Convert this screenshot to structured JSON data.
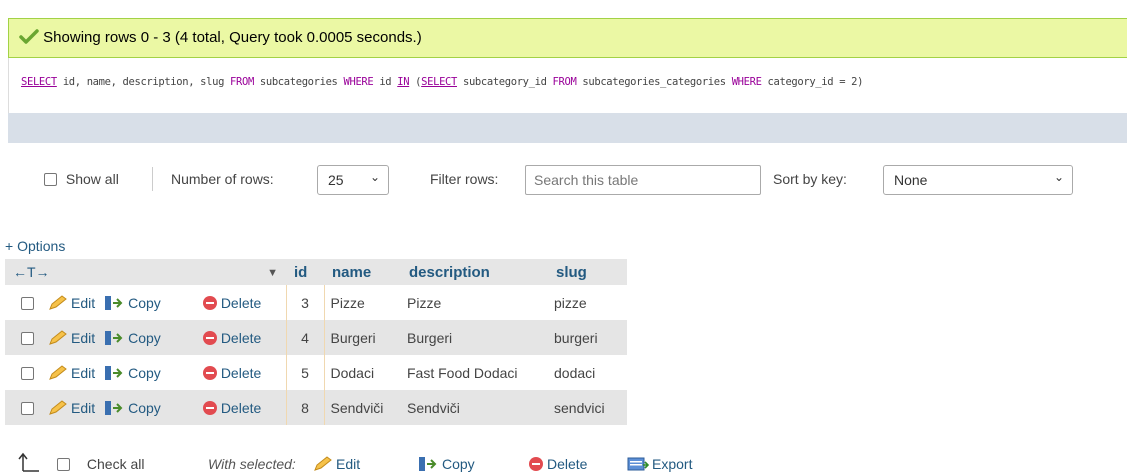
{
  "status": {
    "message": "Showing rows 0 - 3 (4 total, Query took 0.0005 seconds.)",
    "color": "#ebf8a4"
  },
  "sql": {
    "kw_select": "SELECT",
    "part1": " id, name, description, slug ",
    "kw_from": "FROM",
    "part2": " subcategories ",
    "kw_where": "WHERE",
    "part3": " id ",
    "kw_in": "IN",
    "part4": " (",
    "kw_select2": "SELECT",
    "part5": " subcategory_id ",
    "kw_from2": "FROM",
    "part6": " subcategories_categories ",
    "kw_where2": "WHERE",
    "part7": " category_id = 2)"
  },
  "nav": {
    "show_all": "Show all",
    "number_of_rows_label": "Number of rows:",
    "rows_value": "25",
    "filter_label": "Filter rows:",
    "filter_placeholder": "Search this table",
    "sort_label": "Sort by key:",
    "sort_value": "None"
  },
  "options_link": "+ Options",
  "table": {
    "arrows": "←T→",
    "columns": [
      "id",
      "name",
      "description",
      "slug"
    ],
    "actions": {
      "edit": "Edit",
      "copy": "Copy",
      "delete": "Delete"
    },
    "rows": [
      {
        "id": "3",
        "name": "Pizze",
        "description": "Pizze",
        "slug": "pizze"
      },
      {
        "id": "4",
        "name": "Burgeri",
        "description": "Burgeri",
        "slug": "burgeri"
      },
      {
        "id": "5",
        "name": "Dodaci",
        "description": "Fast Food Dodaci",
        "slug": "dodaci"
      },
      {
        "id": "8",
        "name": "Sendviči",
        "description": "Sendviči",
        "slug": "sendvici"
      }
    ]
  },
  "bottom": {
    "check_all": "Check all",
    "with_selected": "With selected:",
    "edit": "Edit",
    "copy": "Copy",
    "delete": "Delete",
    "export": "Export"
  }
}
